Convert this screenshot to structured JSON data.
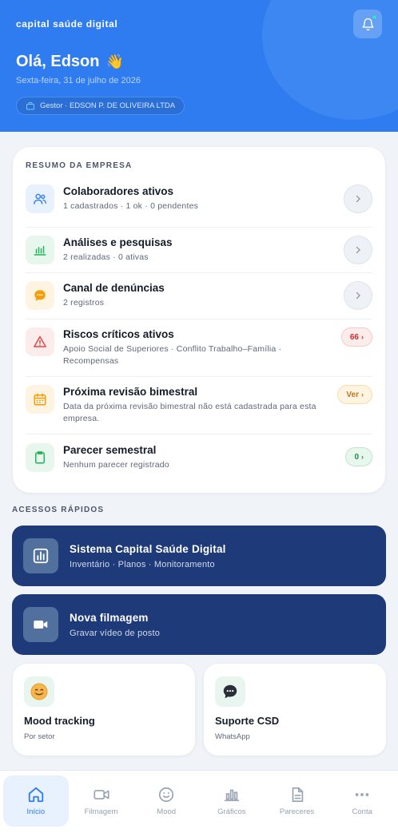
{
  "header": {
    "brand": "capital saúde digital",
    "greeting": "Olá, Edson",
    "greeting_emoji": "👋",
    "date": "Sexta-feira, 31 de julho de 2026",
    "role": "Gestor · EDSON P. DE OLIVEIRA LTDA",
    "bell_icon": "bell-icon",
    "bell_has_dot": true
  },
  "summary": {
    "title": "RESUMO DA EMPRESA",
    "items": [
      {
        "title": "Colaboradores ativos",
        "subtitle": "1 cadastrados · 1 ok · 0 pendentes",
        "icon": "users-icon",
        "action": "chevron",
        "icon_bg": "#e9f1fd",
        "icon_color": "#3b82f6"
      },
      {
        "title": "Análises e pesquisas",
        "subtitle": "2 realizadas · 0 ativas",
        "icon": "bar-chart-icon",
        "action": "chevron",
        "icon_bg": "#e8f7ee",
        "icon_color": "#22b455"
      },
      {
        "title": "Canal de denúncias",
        "subtitle": "2 registros",
        "icon": "chat-bubble-icon",
        "action": "chevron",
        "icon_bg": "#fff4e2",
        "icon_color": "#f59e0b"
      },
      {
        "title": "Riscos críticos ativos",
        "subtitle": "Apoio Social de Superiores · Conflito Trabalho–Família · Recompensas",
        "icon": "warning-icon",
        "action": "badge",
        "badge": "66",
        "badge_bg": "#fdecec",
        "badge_border": "#f6caca",
        "badge_color": "#d12b2b",
        "icon_bg": "#fdecec",
        "icon_color": "#e04848"
      },
      {
        "title": "Próxima revisão bimestral",
        "subtitle": "Data da próxima revisão bimestral não está cadastrada para esta empresa.",
        "icon": "calendar-icon",
        "action": "badge",
        "badge": "Ver",
        "badge_bg": "#fff4e2",
        "badge_border": "#f8dca8",
        "badge_color": "#b7791f",
        "icon_bg": "#fff4e2",
        "icon_color": "#f59e0b"
      },
      {
        "title": "Parecer semestral",
        "subtitle": "Nenhum parecer registrado",
        "icon": "clipboard-icon",
        "action": "badge",
        "badge": "0",
        "badge_bg": "#e8f7ee",
        "badge_border": "#bfe6cc",
        "badge_color": "#1f8f4a",
        "icon_bg": "#e8f7ee",
        "icon_color": "#22b455"
      }
    ]
  },
  "quick_access": {
    "title": "ACESSOS RÁPIDOS",
    "primary": [
      {
        "name": "Sistema Capital Saúde Digital",
        "subtitle": "Inventário · Planos · Monitoramento",
        "icon": "bar-chart-icon"
      },
      {
        "name": "Nova filmagem",
        "subtitle": "Gravar vídeo de posto",
        "icon": "video-camera-icon"
      }
    ],
    "secondary": [
      {
        "name": "Mood tracking",
        "subtitle": "Por setor",
        "icon": "smiley-icon"
      },
      {
        "name": "Suporte CSD",
        "subtitle": "WhatsApp",
        "icon": "chat-bubble-icon"
      }
    ]
  },
  "nav": {
    "items": [
      {
        "label": "Início",
        "icon": "home-icon",
        "active": true
      },
      {
        "label": "Filmagem",
        "icon": "video-camera-icon",
        "active": false
      },
      {
        "label": "Mood",
        "icon": "smiley-icon",
        "active": false
      },
      {
        "label": "Gráficos",
        "icon": "bar-chart-icon",
        "active": false
      },
      {
        "label": "Pareceres",
        "icon": "document-icon",
        "active": false
      },
      {
        "label": "Conta",
        "icon": "more-icon",
        "active": false
      }
    ]
  },
  "colors": {
    "header_bg": "#2f7cf0",
    "card_dark": "#1e3a78",
    "accent": "#2f7cf0",
    "page_bg": "#f0f4f9"
  }
}
